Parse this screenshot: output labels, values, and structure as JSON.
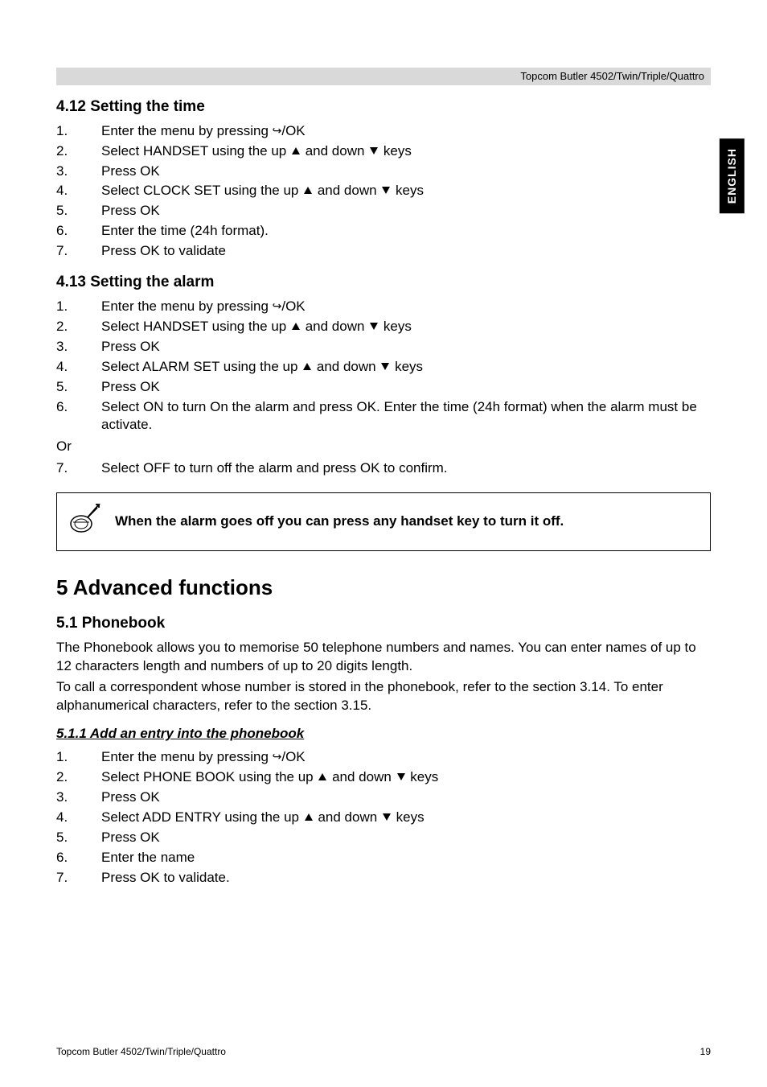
{
  "header": {
    "product": "Topcom Butler 4502/Twin/Triple/Quattro"
  },
  "side_tab": "ENGLISH",
  "s412": {
    "title": "4.12   Setting the time",
    "steps": [
      "Enter the menu by pressing  {redial}/OK",
      "Select HANDSET using the up {up} and down {down} keys",
      "Press OK",
      "Select CLOCK SET using the up {up} and down {down} keys",
      "Press OK",
      "Enter the time (24h format).",
      "Press OK to validate"
    ]
  },
  "s413": {
    "title": "4.13   Setting the alarm",
    "steps_a": [
      "Enter the menu by pressing  {redial}/OK",
      "Select HANDSET using the up {up} and down {down} keys",
      "Press OK",
      "Select ALARM SET using the up {up} and down {down} keys",
      "Press OK",
      "Select ON to turn On the alarm and press OK.  Enter the time (24h format) when the alarm must be activate."
    ],
    "or": "Or",
    "steps_b": [
      "Select OFF to turn off the alarm and press OK to confirm."
    ],
    "step_b_start": 7
  },
  "note": "When the alarm goes off you can press any handset key to turn it off.",
  "s5": {
    "title": "5    Advanced functions",
    "s51_title": "5.1    Phonebook",
    "s51_body": [
      "The Phonebook allows you to memorise 50 telephone numbers and names. You can enter names of up to 12 characters length and numbers of up to 20 digits length.",
      "To call a correspondent whose number is stored in the phonebook, refer to the section 3.14. To enter alphanumerical characters, refer to the section 3.15."
    ],
    "s511_title": "5.1.1 Add an entry into the phonebook",
    "s511_steps": [
      "Enter the menu by pressing  {redial}/OK",
      "Select PHONE BOOK using the up {up} and down {down} keys",
      "Press OK",
      "Select ADD ENTRY using the up {up} and down {down} keys",
      "Press OK",
      "Enter the name",
      "Press OK to validate."
    ]
  },
  "footer": {
    "left": "Topcom Butler 4502/Twin/Triple/Quattro",
    "right": "19"
  }
}
